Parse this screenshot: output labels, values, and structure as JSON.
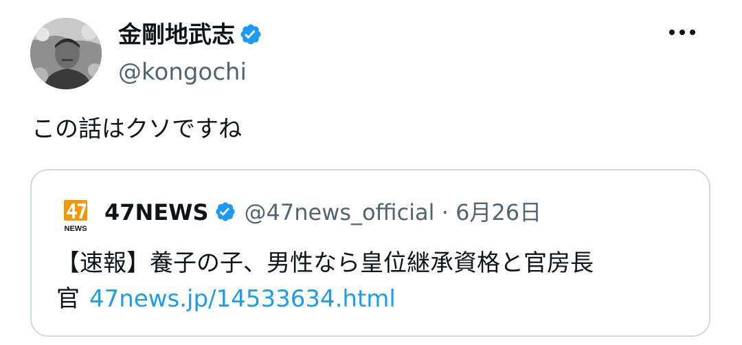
{
  "author": {
    "display_name": "金剛地武志",
    "handle": "@kongochi"
  },
  "tweet": {
    "text": "この話はクソですね"
  },
  "quote": {
    "logo_text": "NEWS",
    "display_name": "47NEWS",
    "handle": "@47news_official",
    "separator": " · ",
    "date": "6月26日",
    "text_line1": "【速報】養子の子、男性なら皇位継承資格と官房長",
    "text_line2": "官",
    "link": "47news.jp/14533634.html"
  },
  "icons": {
    "verified": "verified-badge-icon",
    "more": "more-options-icon"
  },
  "colors": {
    "verified_blue": "#1d9bf0",
    "link_blue": "#1d9bf0",
    "text_primary": "#0f1419",
    "text_secondary": "#536471",
    "card_border": "#cfd9de",
    "logo_orange": "#f39800"
  }
}
